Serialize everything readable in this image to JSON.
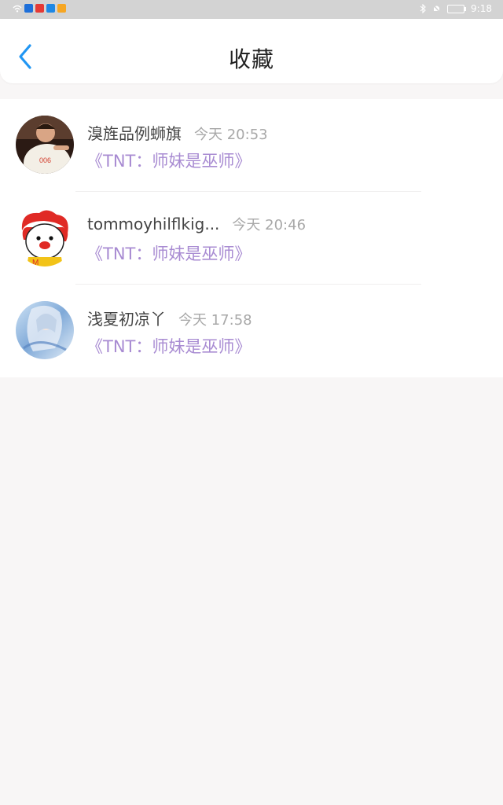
{
  "status_bar": {
    "time": "9:18",
    "battery_icon": "battery-icon",
    "app_icon_colors": [
      "#1e6fd9",
      "#e53935",
      "#1e88e5",
      "#f6a623"
    ]
  },
  "header": {
    "title": "收藏",
    "back_icon": "chevron-left-icon",
    "accent_color": "#2196f3"
  },
  "favorites": [
    {
      "user": "溴旌品例蛳旗",
      "time": "今天 20:53",
      "work": "《TNT：师妹是巫师》"
    },
    {
      "user": "tommoyhilflkig...",
      "time": "今天 20:46",
      "work": "《TNT：师妹是巫师》"
    },
    {
      "user": "浅夏初凉丫",
      "time": "今天 17:58",
      "work": "《TNT：师妹是巫师》"
    }
  ]
}
